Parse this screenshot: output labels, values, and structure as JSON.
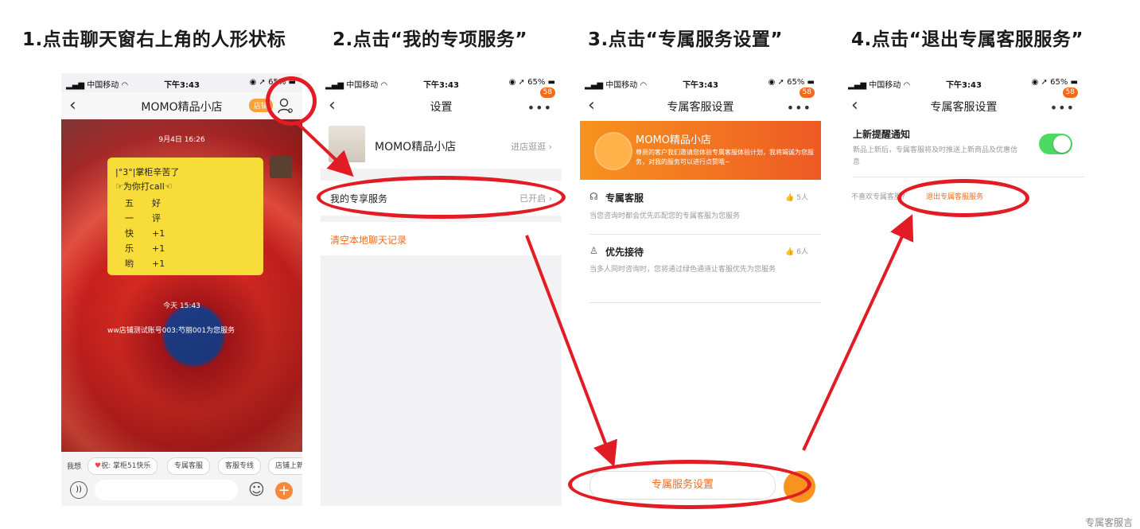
{
  "steps": [
    {
      "title": "1.点击聊天窗右上角的人形状标"
    },
    {
      "title": "2.点击“我的专项服务”"
    },
    {
      "title": "3.点击“专属服务设置”"
    },
    {
      "title": "4.点击“退出专属客服服务”"
    }
  ],
  "status": {
    "carrier": "中国移动",
    "time": "下午3:43",
    "battery": "65%"
  },
  "phone1": {
    "title": "MOMO精品小店",
    "shop_btn": "店铺",
    "date_stamp": "9月4日 16:26",
    "sticker": {
      "line1": "|°3°|掌柜辛苦了",
      "line2": "☞为你打call☜",
      "rows": [
        [
          "五",
          "好"
        ],
        [
          "一",
          "评"
        ],
        [
          "快",
          "+1"
        ],
        [
          "乐",
          "+1"
        ],
        [
          "哟",
          "+1"
        ]
      ]
    },
    "today_stamp": "今天 15:43",
    "system_msg": "ww店铺测试账号003:芍丽001为您服务",
    "quick_label": "我想",
    "chips": [
      "祝: 掌柜51快乐",
      "专属客服",
      "客服专线",
      "店铺上新"
    ],
    "send_icon": "plus-icon"
  },
  "phone2": {
    "title": "设置",
    "badge": "58",
    "shop_name": "MOMO精品小店",
    "shop_link": "进店逛逛",
    "service_label": "我的专享服务",
    "service_status": "已开启",
    "clear_label": "清空本地聊天记录"
  },
  "phone3": {
    "title": "专属客服设置",
    "badge": "58",
    "banner_title": "MOMO精品小店",
    "banner_text": "尊贵的客户我们邀请您体验专属客服体验计划，我将竭诚为您服务，对我的服务可以进行点赞哦~",
    "items": [
      {
        "name": "专属客服",
        "likes": "5人",
        "desc": "当您咨询时都会优先匹配您的专属客服为您服务"
      },
      {
        "name": "优先接待",
        "likes": "6人",
        "desc": "当多人同时咨询时，您将通过绿色通道让客服优先为您服务"
      }
    ],
    "bottom_btn": "专属服务设置"
  },
  "phone4": {
    "title": "专属客服设置",
    "badge": "58",
    "notify_title": "上新提醒通知",
    "notify_desc": "新品上新后，专属客服将及时推送上新商品及优惠信息",
    "toggle_on": true,
    "dislike_text": "不喜欢专属客服?",
    "exit_link": "退出专属客服服务"
  },
  "watermark": "专属客服言",
  "colors": {
    "accent": "#ef6c1e",
    "annotation": "#e21c24",
    "toggle": "#4cd964"
  }
}
